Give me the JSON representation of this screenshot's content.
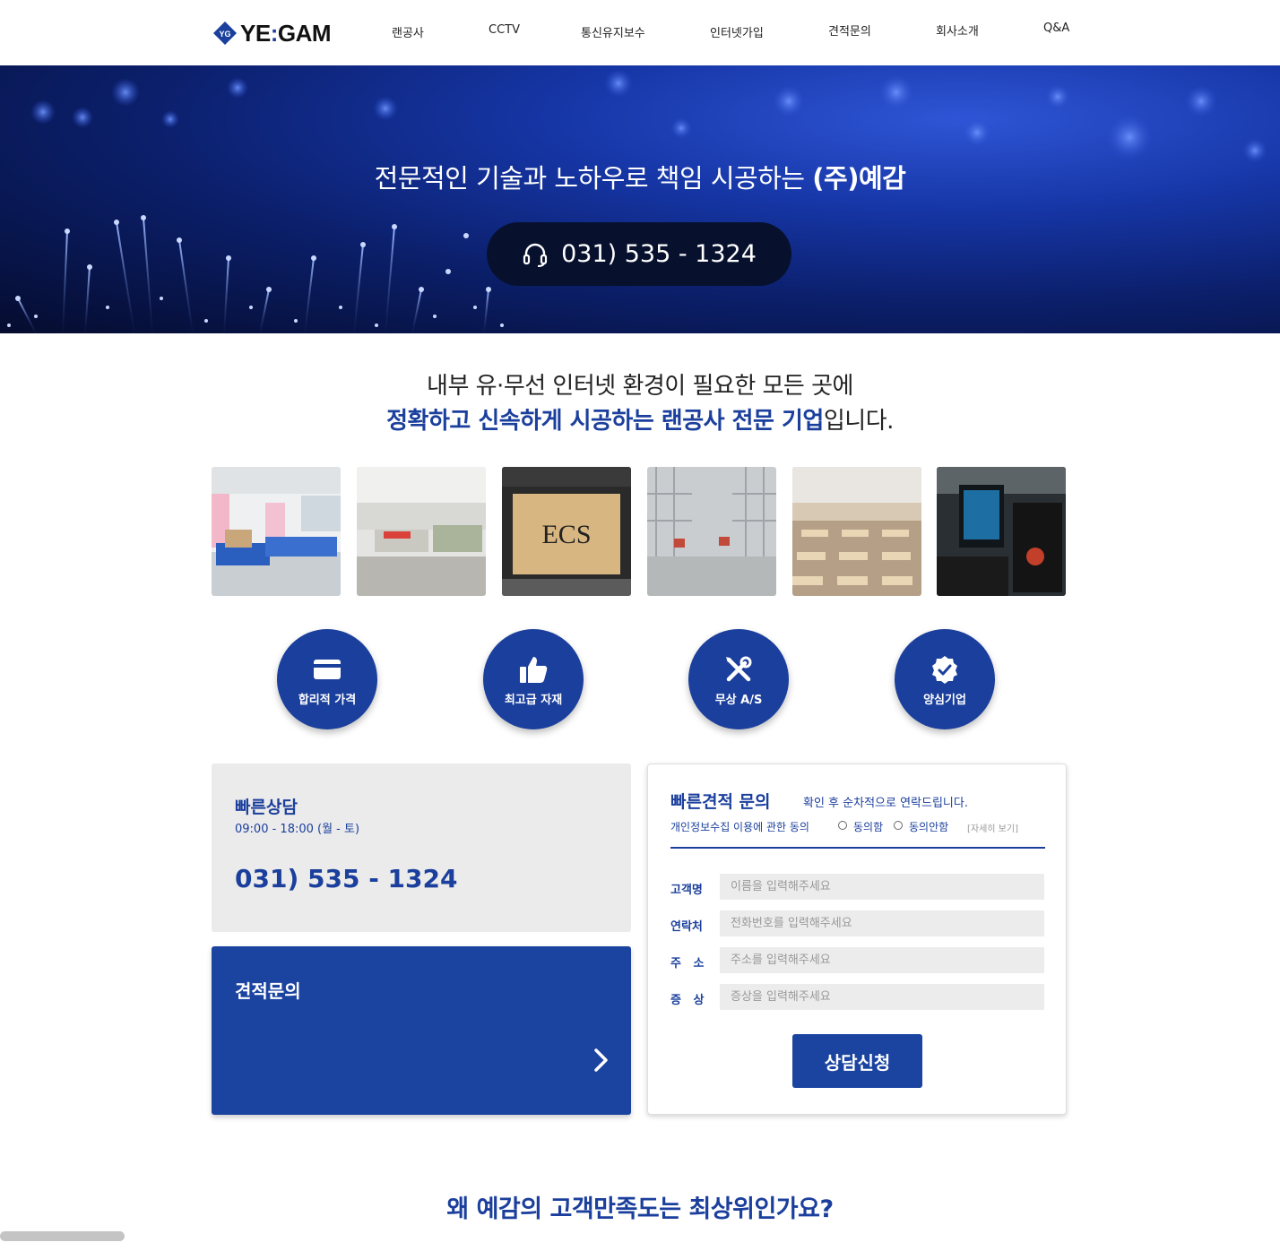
{
  "header": {
    "logo": {
      "text_left": "YE",
      "separator": ":",
      "text_right": "GAM",
      "mark": "YG"
    },
    "nav": [
      {
        "label": "랜공사"
      },
      {
        "label": "CCTV"
      },
      {
        "label": "통신유지보수"
      },
      {
        "label": "인터넷가입"
      },
      {
        "label": "견적문의"
      },
      {
        "label": "회사소개"
      },
      {
        "label": "Q&A"
      }
    ]
  },
  "hero": {
    "title_plain": "전문적인 기술과 노하우로 책임 시공하는 ",
    "title_bold": "(주)예감",
    "phone": "031) 535 - 1324",
    "phone_icon": "headset-icon"
  },
  "intro": {
    "line1": "내부 유·무선 인터넷 환경이 필요한 모든 곳에",
    "line2_highlight": "정확하고 신속하게 시공하는 랜공사 전문 기업",
    "line2_rest": "입니다."
  },
  "photos": [
    {
      "name": "hospital-ward-photo"
    },
    {
      "name": "office-photo"
    },
    {
      "name": "storefront-photo"
    },
    {
      "name": "warehouse-photo"
    },
    {
      "name": "classroom-photo"
    },
    {
      "name": "pc-gaming-photo"
    }
  ],
  "features": [
    {
      "label": "합리적 가격",
      "icon": "credit-card-icon"
    },
    {
      "label": "최고급 자재",
      "icon": "thumbs-up-icon"
    },
    {
      "label": "무상 A/S",
      "icon": "tools-icon"
    },
    {
      "label": "양심기업",
      "icon": "verified-badge-icon"
    }
  ],
  "consult": {
    "title": "빠른상담",
    "hours": "09:00 - 18:00 (월 - 토)",
    "phone": "031) 535 - 1324"
  },
  "quote": {
    "title": "견적문의",
    "arrow_icon": "chevron-right-icon"
  },
  "form": {
    "title": "빠른견적 문의",
    "subtitle": "확인 후 순차적으로 연락드립니다.",
    "privacy_label": "개인정보수집 이용에 관한 동의",
    "agree_label": "동의함",
    "disagree_label": "동의안함",
    "detail_link": "[자세히 보기]",
    "fields": [
      {
        "label": "고객명",
        "placeholder": "이름을 입력해주세요"
      },
      {
        "label": "연락처",
        "placeholder": "전화번호를 입력해주세요"
      },
      {
        "label": "주   소",
        "placeholder": "주소를 입력해주세요"
      },
      {
        "label": "증   상",
        "placeholder": "증상을 입력해주세요"
      }
    ],
    "submit_label": "상담신청"
  },
  "bottom": {
    "title": "왜 예감의 고객만족도는 최상위인가요?"
  },
  "colors": {
    "brand_blue": "#1b3f9c",
    "panel_gray": "#ebebeb",
    "input_gray": "#ececec"
  }
}
